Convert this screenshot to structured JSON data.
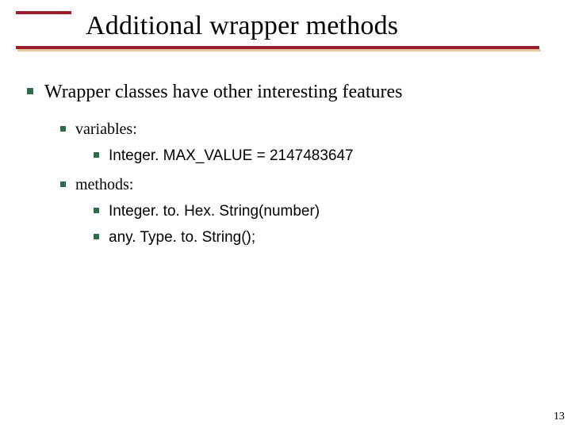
{
  "title": "Additional wrapper methods",
  "body": {
    "main": "Wrapper classes have other interesting features",
    "sub": [
      {
        "label": "variables:",
        "items": [
          "Integer. MAX_VALUE = 2147483647"
        ]
      },
      {
        "label": "methods:",
        "items": [
          "Integer. to. Hex. String(number)",
          "any. Type. to. String();"
        ]
      }
    ]
  },
  "page": "13",
  "colors": {
    "accent": "#9a1f2e",
    "bullet": "#2f6b46",
    "shadow": "#e9c7a0"
  }
}
